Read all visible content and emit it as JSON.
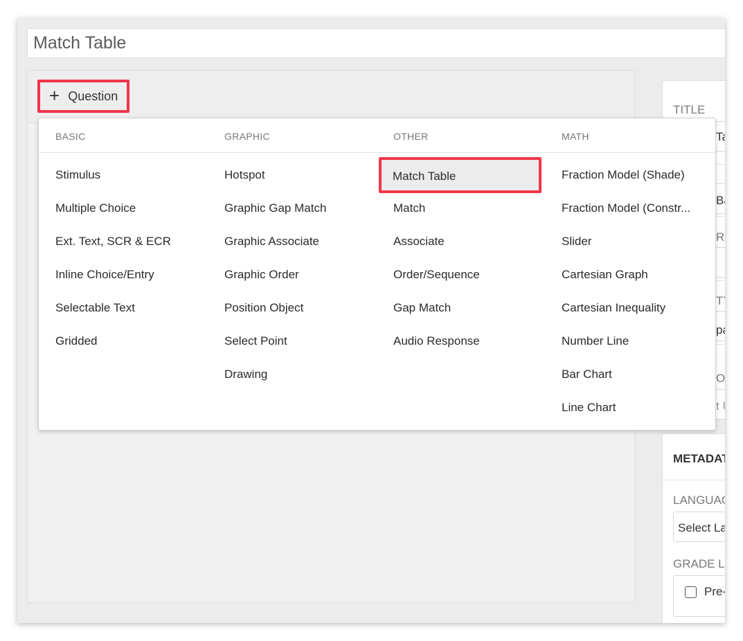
{
  "title_input": {
    "value": "Match Table"
  },
  "toolbar": {
    "add_question_label": "Question"
  },
  "question_menu": {
    "columns": [
      {
        "header": "BASIC",
        "items": [
          "Stimulus",
          "Multiple Choice",
          "Ext. Text, SCR & ECR",
          "Inline Choice/Entry",
          "Selectable Text",
          "Gridded"
        ]
      },
      {
        "header": "GRAPHIC",
        "items": [
          "Hotspot",
          "Graphic Gap Match",
          "Graphic Associate",
          "Graphic Order",
          "Position Object",
          "Select Point",
          "Drawing"
        ]
      },
      {
        "header": "OTHER",
        "items": [
          "Match Table",
          "Match",
          "Associate",
          "Order/Sequence",
          "Gap Match",
          "Audio Response"
        ]
      },
      {
        "header": "MATH",
        "items": [
          "Fraction Model (Shade)",
          "Fraction Model (Constr...",
          "Slider",
          "Cartesian Graph",
          "Cartesian Inequality",
          "Number Line",
          "Bar Chart",
          "Line Chart"
        ]
      }
    ],
    "selected": "Match Table"
  },
  "sidebar": {
    "title_label": "TITLE",
    "frag_ta": "Ta",
    "frag_ba": "Ba",
    "frag_r": "R",
    "frag_ty": "TY",
    "frag_pa": "pa",
    "frag_or": "OR",
    "frag_tu": "t U",
    "metadata_label": "METADAT",
    "language_label": "LANGUAG",
    "language_select": "Select La",
    "grade_label": "GRADE LE",
    "grade_option": "Pre-"
  },
  "colors": {
    "highlight": "#f0364b"
  }
}
